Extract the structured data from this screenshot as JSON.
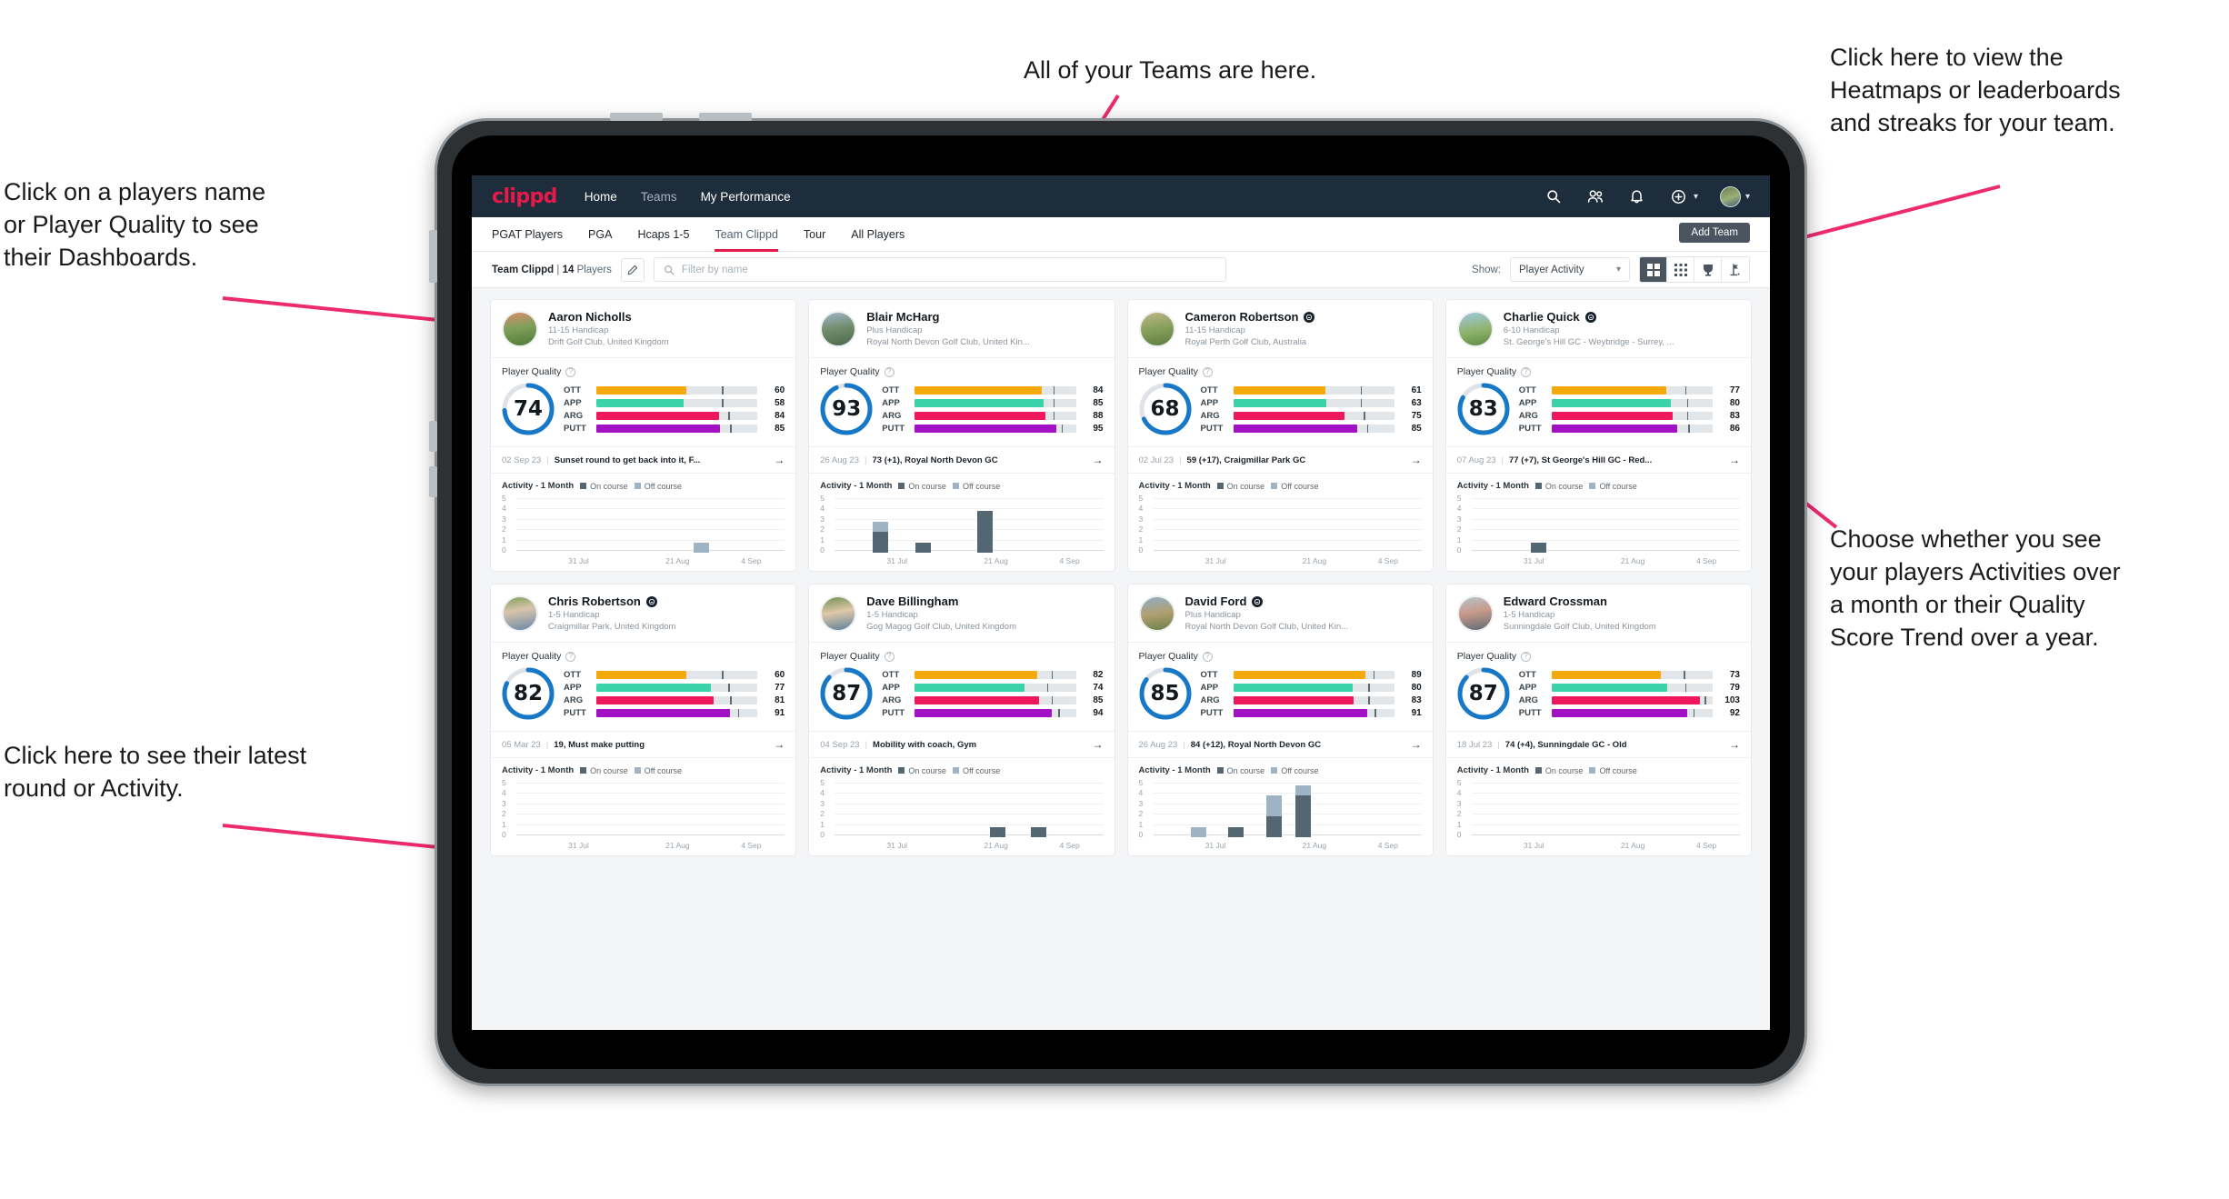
{
  "annotations": [
    {
      "id": "teams",
      "text": "All of your Teams are here."
    },
    {
      "id": "heatmaps",
      "text": "Click here to view the\nHeatmaps or leaderboards\nand streaks for your team."
    },
    {
      "id": "players",
      "text": "Click on a players name\nor Player Quality to see\ntheir Dashboards."
    },
    {
      "id": "show",
      "text": "Choose whether you see\nyour players Activities over\na month or their Quality\nScore Trend over a year."
    },
    {
      "id": "latest",
      "text": "Click here to see their latest\nround or Activity."
    }
  ],
  "app": {
    "logo": "clippd",
    "nav": [
      {
        "label": "Home",
        "active": true
      },
      {
        "label": "Teams",
        "active": false
      },
      {
        "label": "My Performance",
        "active": true
      }
    ],
    "nav_icons": [
      "search-icon",
      "people-icon",
      "bell-icon",
      "plus-circle-icon",
      "avatar"
    ]
  },
  "tabs": [
    {
      "label": "PGAT Players",
      "active": false
    },
    {
      "label": "PGA",
      "active": false
    },
    {
      "label": "Hcaps 1-5",
      "active": false
    },
    {
      "label": "Team Clippd",
      "active": true
    },
    {
      "label": "Tour",
      "active": false
    },
    {
      "label": "All Players",
      "active": false
    }
  ],
  "add_team_label": "Add Team",
  "toolbar": {
    "team_name": "Team Clippd",
    "separator": "|",
    "player_count": "14",
    "players_word": "Players",
    "edit_icon": "pencil-icon",
    "search_placeholder": "Filter by name",
    "search_value": "",
    "show_label": "Show:",
    "show_value": "Player Activity",
    "views": [
      {
        "name": "grid-view",
        "icon": "grid-4-icon",
        "active": true
      },
      {
        "name": "dense-grid-view",
        "icon": "grid-9-icon",
        "active": false
      },
      {
        "name": "leaderboard-view",
        "icon": "trophy-icon",
        "active": false
      },
      {
        "name": "heatmap-view",
        "icon": "golf-flag-icon",
        "active": false
      }
    ]
  },
  "card_labels": {
    "player_quality": "Player Quality",
    "activity_title": "Activity - 1 Month",
    "legend_on": "On course",
    "legend_off": "Off course",
    "x_ticks": [
      "31 Jul",
      "21 Aug",
      "4 Sep"
    ],
    "y_ticks": [
      "5",
      "4",
      "3",
      "2",
      "1",
      "0"
    ],
    "metrics": [
      "OTT",
      "APP",
      "ARG",
      "PUTT"
    ]
  },
  "colors": {
    "accent": "#e6194b",
    "nav_bg": "#1e2d3b",
    "ring": "#1878c8",
    "ott": "#f5a90a",
    "app": "#3ad2a8",
    "arg": "#f0185c",
    "putt": "#a212c4",
    "on_course": "#556673",
    "off_course": "#9eb3c4"
  },
  "players": [
    {
      "name": "Aaron Nicholls",
      "verified": false,
      "handicap": "11-15 Handicap",
      "club": "Drift Golf Club, United Kingdom",
      "quality": 74,
      "metrics": [
        {
          "key": "OTT",
          "value": 60,
          "fill_pct": 56,
          "tick_pct": 78
        },
        {
          "key": "APP",
          "value": 58,
          "fill_pct": 54,
          "tick_pct": 78
        },
        {
          "key": "ARG",
          "value": 84,
          "fill_pct": 76,
          "tick_pct": 82
        },
        {
          "key": "PUTT",
          "value": 85,
          "fill_pct": 77,
          "tick_pct": 83
        }
      ],
      "round": {
        "date": "02 Sep 23",
        "text": "Sunset round to get back into it, F..."
      },
      "activity": [
        {
          "x": 66,
          "on": 0,
          "off": 1
        }
      ],
      "avatar": "linear-gradient(170deg,#d98b6a 0%,#7fa05a 45%,#4f7a3a 100%)"
    },
    {
      "name": "Blair McHarg",
      "verified": false,
      "handicap": "Plus Handicap",
      "club": "Royal North Devon Golf Club, United Kin...",
      "quality": 93,
      "metrics": [
        {
          "key": "OTT",
          "value": 84,
          "fill_pct": 79,
          "tick_pct": 86
        },
        {
          "key": "APP",
          "value": 85,
          "fill_pct": 80,
          "tick_pct": 86
        },
        {
          "key": "ARG",
          "value": 88,
          "fill_pct": 81,
          "tick_pct": 86
        },
        {
          "key": "PUTT",
          "value": 95,
          "fill_pct": 88,
          "tick_pct": 91
        }
      ],
      "round": {
        "date": "26 Aug 23",
        "text": "73 (+1), Royal North Devon GC"
      },
      "activity": [
        {
          "x": 14,
          "on": 2,
          "off": 1
        },
        {
          "x": 30,
          "on": 1,
          "off": 0
        },
        {
          "x": 53,
          "on": 4,
          "off": 0
        }
      ],
      "avatar": "linear-gradient(170deg,#9fb6c8 0%,#6f8a6a 50%,#4a6b4c 100%)"
    },
    {
      "name": "Cameron Robertson",
      "verified": true,
      "handicap": "11-15 Handicap",
      "club": "Royal Perth Golf Club, Australia",
      "quality": 68,
      "metrics": [
        {
          "key": "OTT",
          "value": 61,
          "fill_pct": 57,
          "tick_pct": 79
        },
        {
          "key": "APP",
          "value": 63,
          "fill_pct": 58,
          "tick_pct": 79
        },
        {
          "key": "ARG",
          "value": 75,
          "fill_pct": 69,
          "tick_pct": 81
        },
        {
          "key": "PUTT",
          "value": 85,
          "fill_pct": 77,
          "tick_pct": 83
        }
      ],
      "round": {
        "date": "02 Jul 23",
        "text": "59 (+17), Craigmillar Park GC"
      },
      "activity": [],
      "avatar": "linear-gradient(170deg,#c2b48a 0%,#8aa25e 45%,#5d7d42 100%)"
    },
    {
      "name": "Charlie Quick",
      "verified": true,
      "handicap": "6-10 Handicap",
      "club": "St. George's Hill GC - Weybridge - Surrey, ...",
      "quality": 83,
      "metrics": [
        {
          "key": "OTT",
          "value": 77,
          "fill_pct": 71,
          "tick_pct": 83
        },
        {
          "key": "APP",
          "value": 80,
          "fill_pct": 74,
          "tick_pct": 84
        },
        {
          "key": "ARG",
          "value": 83,
          "fill_pct": 75,
          "tick_pct": 84
        },
        {
          "key": "PUTT",
          "value": 86,
          "fill_pct": 78,
          "tick_pct": 85
        }
      ],
      "round": {
        "date": "07 Aug 23",
        "text": "77 (+7), St George's Hill GC - Red..."
      },
      "activity": [
        {
          "x": 22,
          "on": 1,
          "off": 0
        }
      ],
      "avatar": "linear-gradient(170deg,#9fc8e0 0%,#8fb36a 55%,#5d8a46 100%)"
    },
    {
      "name": "Chris Robertson",
      "verified": true,
      "handicap": "1-5 Handicap",
      "club": "Craigmillar Park, United Kingdom",
      "quality": 82,
      "metrics": [
        {
          "key": "OTT",
          "value": 60,
          "fill_pct": 56,
          "tick_pct": 78
        },
        {
          "key": "APP",
          "value": 77,
          "fill_pct": 71,
          "tick_pct": 82
        },
        {
          "key": "ARG",
          "value": 81,
          "fill_pct": 73,
          "tick_pct": 83
        },
        {
          "key": "PUTT",
          "value": 91,
          "fill_pct": 83,
          "tick_pct": 88
        }
      ],
      "round": {
        "date": "05 Mar 23",
        "text": "19, Must make putting"
      },
      "activity": [],
      "avatar": "linear-gradient(170deg,#7fa05a 0%,#d8c4ac 40%,#6a89a8 100%)"
    },
    {
      "name": "Dave Billingham",
      "verified": false,
      "handicap": "1-5 Handicap",
      "club": "Gog Magog Golf Club, United Kingdom",
      "quality": 87,
      "metrics": [
        {
          "key": "OTT",
          "value": 82,
          "fill_pct": 76,
          "tick_pct": 85
        },
        {
          "key": "APP",
          "value": 74,
          "fill_pct": 68,
          "tick_pct": 82
        },
        {
          "key": "ARG",
          "value": 85,
          "fill_pct": 77,
          "tick_pct": 85
        },
        {
          "key": "PUTT",
          "value": 94,
          "fill_pct": 85,
          "tick_pct": 89
        }
      ],
      "round": {
        "date": "04 Sep 23",
        "text": "Mobility with coach, Gym"
      },
      "activity": [
        {
          "x": 58,
          "on": 1,
          "off": 0
        },
        {
          "x": 73,
          "on": 1,
          "off": 0
        }
      ],
      "avatar": "linear-gradient(170deg,#6e8f52 0%,#e0c9a8 45%,#5c7f9c 100%)"
    },
    {
      "name": "David Ford",
      "verified": true,
      "handicap": "Plus Handicap",
      "club": "Royal North Devon Golf Club, United Kin...",
      "quality": 85,
      "metrics": [
        {
          "key": "OTT",
          "value": 89,
          "fill_pct": 82,
          "tick_pct": 87
        },
        {
          "key": "APP",
          "value": 80,
          "fill_pct": 74,
          "tick_pct": 84
        },
        {
          "key": "ARG",
          "value": 83,
          "fill_pct": 75,
          "tick_pct": 84
        },
        {
          "key": "PUTT",
          "value": 91,
          "fill_pct": 83,
          "tick_pct": 88
        }
      ],
      "round": {
        "date": "26 Aug 23",
        "text": "84 (+12), Royal North Devon GC"
      },
      "activity": [
        {
          "x": 14,
          "on": 0,
          "off": 1
        },
        {
          "x": 28,
          "on": 1,
          "off": 0
        },
        {
          "x": 42,
          "on": 2,
          "off": 2
        },
        {
          "x": 53,
          "on": 4,
          "off": 1
        }
      ],
      "avatar": "linear-gradient(170deg,#8fb0c8 0%,#b0a070 50%,#6a7f4a 100%)"
    },
    {
      "name": "Edward Crossman",
      "verified": false,
      "handicap": "1-5 Handicap",
      "club": "Sunningdale Golf Club, United Kingdom",
      "quality": 87,
      "metrics": [
        {
          "key": "OTT",
          "value": 73,
          "fill_pct": 68,
          "tick_pct": 82
        },
        {
          "key": "APP",
          "value": 79,
          "fill_pct": 72,
          "tick_pct": 83
        },
        {
          "key": "ARG",
          "value": 103,
          "fill_pct": 92,
          "tick_pct": 95
        },
        {
          "key": "PUTT",
          "value": 92,
          "fill_pct": 84,
          "tick_pct": 88
        }
      ],
      "round": {
        "date": "18 Jul 23",
        "text": "74 (+4), Sunningdale GC - Old"
      },
      "activity": [],
      "avatar": "linear-gradient(170deg,#b8c4cc 0%,#c89a8a 45%,#5e6a74 100%)"
    }
  ]
}
